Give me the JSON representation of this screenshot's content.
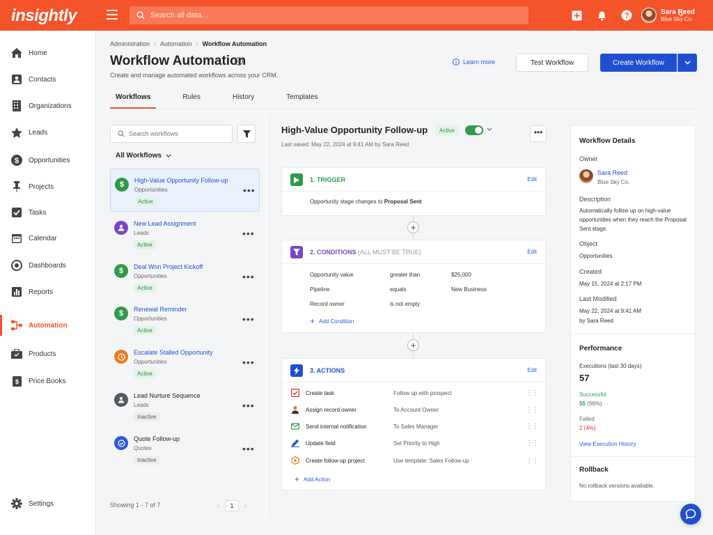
{
  "app": {
    "logo": "insightly",
    "search_placeholder": "Search all data...",
    "user_name": "Sara Reed",
    "user_company": "Blue Sky Co."
  },
  "sidebar": {
    "items": [
      {
        "label": "Home",
        "icon": "home-icon"
      },
      {
        "label": "Contacts",
        "icon": "contacts-icon"
      },
      {
        "label": "Organizations",
        "icon": "building-icon"
      },
      {
        "label": "Leads",
        "icon": "star-icon"
      },
      {
        "label": "Opportunities",
        "icon": "dollar-icon"
      },
      {
        "label": "Projects",
        "icon": "pin-icon"
      },
      {
        "label": "Tasks",
        "icon": "checkbox-icon"
      },
      {
        "label": "Calendar",
        "icon": "calendar-icon"
      },
      {
        "label": "Dashboards",
        "icon": "dashboard-icon"
      },
      {
        "label": "Reports",
        "icon": "bar-chart-icon"
      },
      {
        "label": "Automation",
        "icon": "automation-icon",
        "active": true
      },
      {
        "label": "Products",
        "icon": "products-icon"
      },
      {
        "label": "Price Books",
        "icon": "price-book-icon"
      }
    ],
    "settings": "Settings"
  },
  "header": {
    "breadcrumb": [
      "Administration",
      "Automation",
      "Workflow Automation"
    ],
    "title": "Workflow Automation",
    "subtitle": "Create and manage automated workflows across your CRM.",
    "learn_more": "Learn more",
    "test_button": "Test Workflow",
    "create_button": "Create Workflow"
  },
  "tabs": [
    "Workflows",
    "Rules",
    "History",
    "Templates"
  ],
  "list": {
    "search_placeholder": "Search workflows",
    "filter_label": "All Workflows",
    "items": [
      {
        "name": "High-Value Opportunity Follow-up",
        "category": "Opportunities",
        "status": "Active",
        "color": "#2f9a4d",
        "glyph": "$"
      },
      {
        "name": "New Lead Assignment",
        "category": "Leads",
        "status": "Active",
        "color": "#7b45c8",
        "glyph": "●"
      },
      {
        "name": "Deal Won Project Kickoff",
        "category": "Opportunities",
        "status": "Active",
        "color": "#2f9a4d",
        "glyph": "$"
      },
      {
        "name": "Renewal Reminder",
        "category": "Opportunities",
        "status": "Active",
        "color": "#2f9a4d",
        "glyph": "$"
      },
      {
        "name": "Escalate Stalled Opportunity",
        "category": "Opportunities",
        "status": "Active",
        "color": "#f07a1c",
        "glyph": "◷"
      },
      {
        "name": "Lead Nurture Sequence",
        "category": "Leads",
        "status": "Inactive",
        "color": "#555b63",
        "glyph": "●"
      },
      {
        "name": "Quote Follow-up",
        "category": "Quotes",
        "status": "Inactive",
        "color": "#2a5bd7",
        "glyph": "✓"
      }
    ],
    "showing": "Showing 1 - 7 of 7",
    "page": "1",
    "prev": "‹",
    "next": "›"
  },
  "workflow": {
    "title": "High-Value Opportunity Follow-up",
    "status": "Active",
    "last_saved": "Last saved: May 22, 2024 at 9:41 AM by Sara Reed",
    "more": "•••",
    "trigger": {
      "title": "1. TRIGGER",
      "edit": "Edit",
      "text_prefix": "Opportunity stage changes to ",
      "text_value": "Sent",
      "text_value_full": "Proposal Sent"
    },
    "conditions": {
      "title": "2. CONDITIONS",
      "title_note": "(ALL MUST BE TRUE)",
      "edit": "Edit",
      "rows": [
        {
          "field": "Opportunity value",
          "op": "greater than",
          "value": "$25,000"
        },
        {
          "field": "Pipeline",
          "op": "equals",
          "value": "New Business"
        },
        {
          "field": "Record owner",
          "op": "is not empty",
          "value": ""
        }
      ],
      "add": "Add Condition"
    },
    "actions": {
      "title": "3. ACTIONS",
      "edit": "Edit",
      "rows": [
        {
          "label": "Create task",
          "value": "Follow up with prospect",
          "icon": "task-icon"
        },
        {
          "label": "Assign record owner",
          "value": "To Account Owner",
          "icon": "person-icon"
        },
        {
          "label": "Send internal notification",
          "value": "To Sales Manager",
          "icon": "notification-icon"
        },
        {
          "label": "Update field",
          "value": "Set Priority to High",
          "icon": "pen-icon"
        },
        {
          "label": "Create follow-up project",
          "value": "Use template: Sales Follow-up",
          "icon": "project-icon"
        }
      ],
      "add": "Add Action"
    }
  },
  "details": {
    "title": "Workflow Details",
    "owner_label": "Owner",
    "owner_name": "Sara Reed",
    "owner_company": "Blue Sky Co.",
    "description_label": "Description",
    "description": "Automatically follow up on high-value opportunities when they reach the Proposal Sent stage.",
    "object_label": "Object",
    "object": "Opportunities",
    "created_label": "Created",
    "created": "May 15, 2024 at 2:17 PM",
    "modified_label": "Last Modified",
    "modified": "May 22, 2024 at 9:41 AM",
    "modified_by": "by Sara Reed",
    "performance_title": "Performance",
    "executions_label": "Executions (last 30 days)",
    "executions": "57",
    "successful_label": "Successful",
    "successful_count": "55",
    "successful_pct": "(96%)",
    "failed_label": "Failed",
    "failed_value": "2 (4%)",
    "history_link": "View Execution History",
    "rollback_title": "Rollback",
    "rollback_text": "No rollback versions available."
  },
  "colors": {
    "brand": "#f5532a",
    "primary": "#1f4fd1",
    "success": "#2f9a4d",
    "danger": "#d93025"
  }
}
